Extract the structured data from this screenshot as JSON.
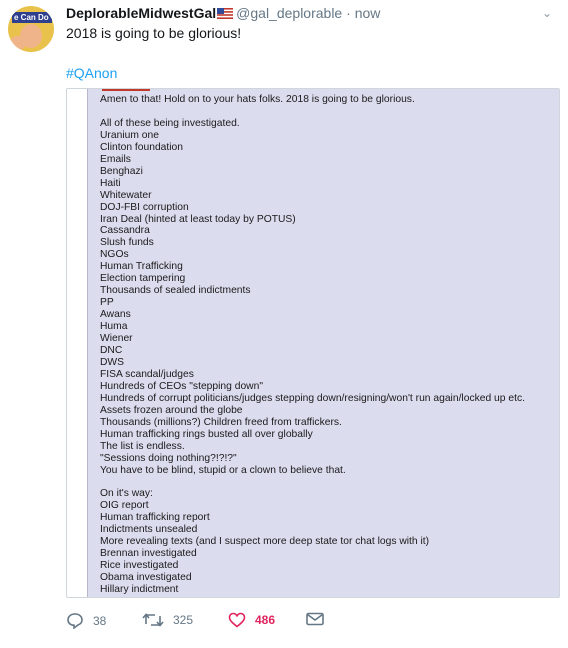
{
  "tweet": {
    "display_name": "DeplorableMidwestGal",
    "handle": "@gal_deplorable",
    "separator": "·",
    "time": "now",
    "avatar_text": "e Can Do",
    "text": "2018 is going to be glorious!",
    "hashtag": "#QAnon"
  },
  "screenshot_text": {
    "lines": [
      "Amen to that! Hold on to your hats folks. 2018 is going to be glorious.",
      "",
      "All of these being investigated.",
      "Uranium one",
      "Clinton foundation",
      "Emails",
      "Benghazi",
      "Haiti",
      "Whitewater",
      "DOJ-FBI corruption",
      "Iran Deal (hinted at least today by POTUS)",
      "Cassandra",
      "Slush funds",
      "NGOs",
      "Human Trafficking",
      "Election tampering",
      "Thousands of sealed indictments",
      "PP",
      "Awans",
      "Huma",
      "Wiener",
      "DNC",
      "DWS",
      "FISA scandal/judges",
      "Hundreds of CEOs \"stepping down\"",
      "Hundreds of corrupt politicians/judges stepping down/resigning/won't run again/locked up etc.",
      "Assets frozen around the globe",
      "Thousands (millions?) Children freed from traffickers.",
      "Human trafficking rings busted all over globally",
      "The list is endless.",
      "\"Sessions doing nothing?!?!?\"",
      "You have to be blind, stupid or a clown to believe that.",
      "",
      "On it's way:",
      "OIG report",
      "Human trafficking report",
      "Indictments unsealed",
      "More revealing texts (and I suspect more deep state tor chat logs with it)",
      "Brennan investigated",
      "Rice investigated",
      "Obama investigated",
      "Hillary indictment"
    ]
  },
  "actions": {
    "reply_count": "38",
    "retweet_count": "325",
    "like_count": "486",
    "reply_icon": "reply-icon",
    "retweet_icon": "retweet-icon",
    "like_icon": "heart-icon",
    "message_icon": "envelope-icon"
  },
  "colors": {
    "link": "#1da1f2",
    "like": "#e0245e",
    "muted": "#657786",
    "screenshot_bg": "#dcdcef"
  }
}
